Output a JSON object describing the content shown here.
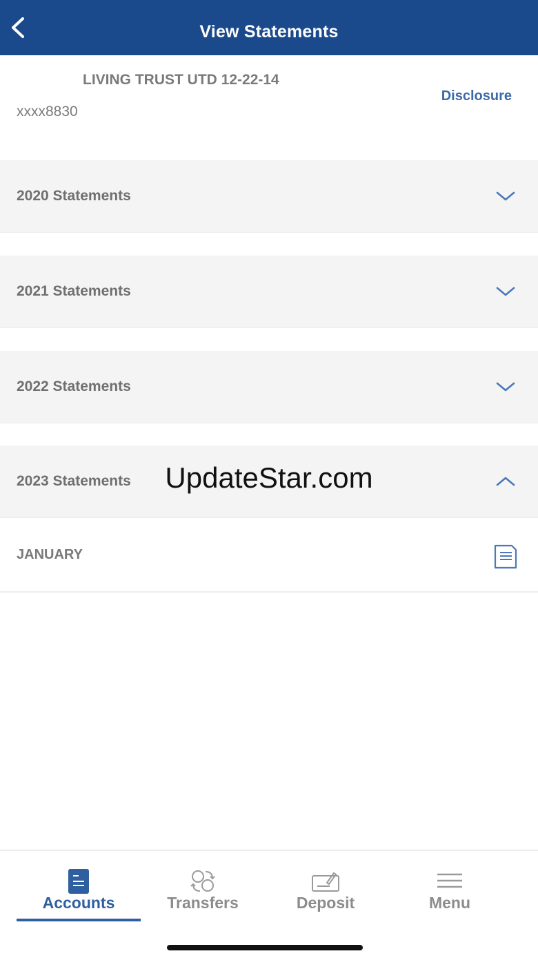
{
  "header": {
    "title": "View Statements"
  },
  "account": {
    "name": "LIVING TRUST UTD 12-22-14",
    "number": "xxxx8830",
    "disclosure_label": "Disclosure"
  },
  "sections": [
    {
      "label": "2020 Statements",
      "expanded": false,
      "chevron_icon": "chevron-down-icon"
    },
    {
      "label": "2021 Statements",
      "expanded": false,
      "chevron_icon": "chevron-down-icon"
    },
    {
      "label": "2022 Statements",
      "expanded": false,
      "chevron_icon": "chevron-down-icon"
    },
    {
      "label": "2023 Statements",
      "expanded": true,
      "chevron_icon": "chevron-up-icon"
    }
  ],
  "months_2023": [
    {
      "label": "JANUARY",
      "icon": "document-icon"
    }
  ],
  "watermark": "UpdateStar.com",
  "tabbar": {
    "active": "Accounts",
    "tabs": [
      {
        "label": "Accounts",
        "icon": "accounts-icon"
      },
      {
        "label": "Transfers",
        "icon": "transfers-icon"
      },
      {
        "label": "Deposit",
        "icon": "deposit-icon"
      },
      {
        "label": "Menu",
        "icon": "menu-icon"
      }
    ]
  },
  "colors": {
    "header_bg": "#1b4a8c",
    "accent": "#2f5f9e",
    "section_bg": "#f4f4f4",
    "chevron": "#4a78b8",
    "muted_text": "#7a7a7a"
  }
}
